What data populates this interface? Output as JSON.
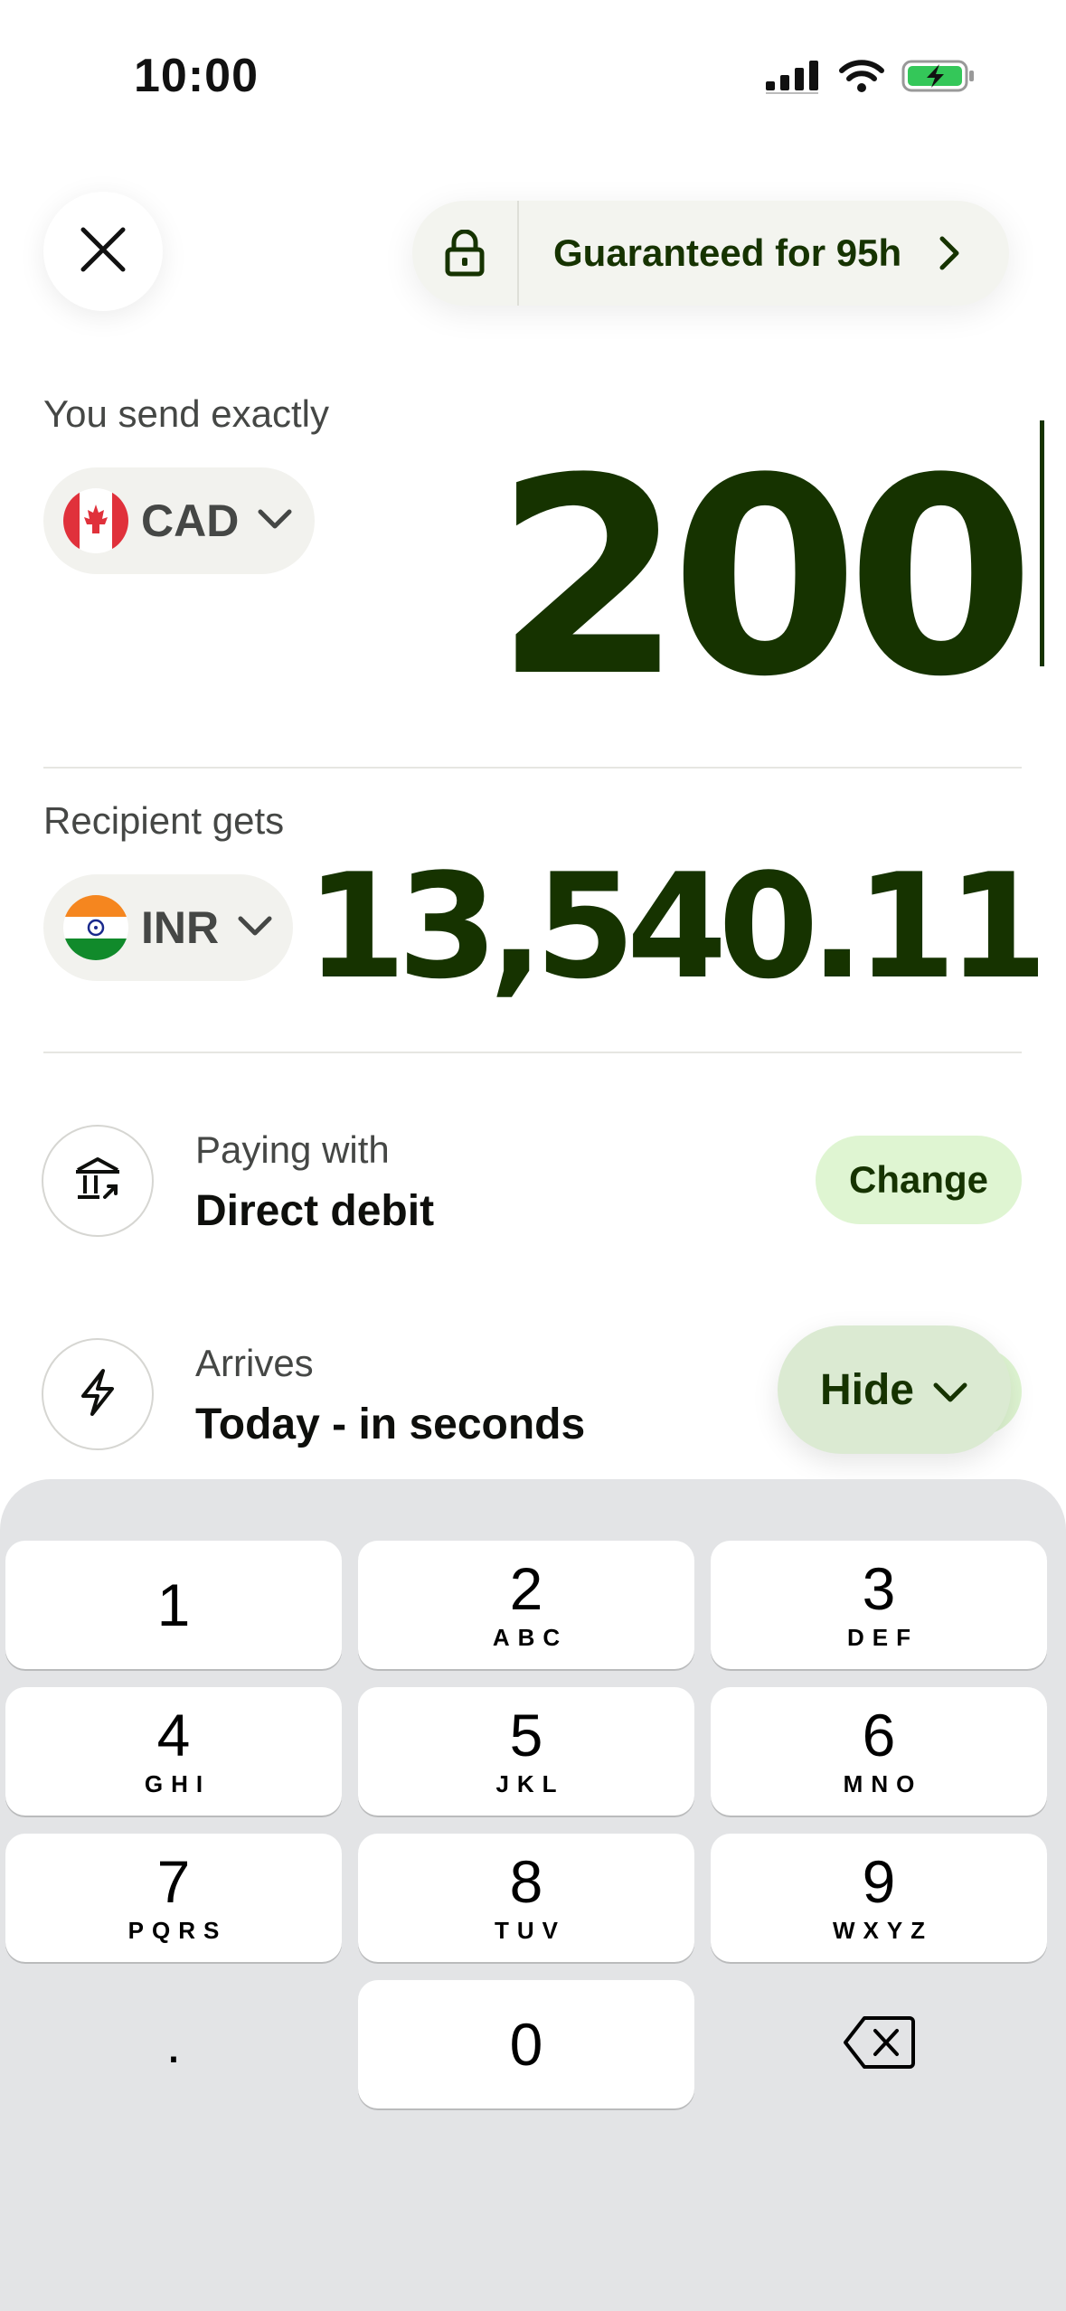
{
  "status_bar": {
    "time": "10:00",
    "icons": [
      "cellular-signal-icon",
      "wifi-icon",
      "battery-charging-icon"
    ],
    "battery_color": "#34c759"
  },
  "header": {
    "close_icon": "close-icon",
    "guarantee_label": "Guaranteed for 95h",
    "lock_icon": "lock-icon",
    "chevron_icon": "chevron-right-icon"
  },
  "send": {
    "label": "You send exactly",
    "currency": "CAD",
    "amount": "200"
  },
  "receive": {
    "label": "Recipient gets",
    "currency": "INR",
    "amount": "13,540.11"
  },
  "paying": {
    "label": "Paying with",
    "value": "Direct debit",
    "action": "Change",
    "icon": "bank-icon"
  },
  "arrives": {
    "label": "Arrives",
    "value": "Today - in seconds",
    "action": "Hide",
    "icon": "lightning-icon"
  },
  "keypad": {
    "keys": [
      {
        "num": "1",
        "letters": ""
      },
      {
        "num": "2",
        "letters": "ABC"
      },
      {
        "num": "3",
        "letters": "DEF"
      },
      {
        "num": "4",
        "letters": "GHI"
      },
      {
        "num": "5",
        "letters": "JKL"
      },
      {
        "num": "6",
        "letters": "MNO"
      },
      {
        "num": "7",
        "letters": "PQRS"
      },
      {
        "num": "8",
        "letters": "TUV"
      },
      {
        "num": "9",
        "letters": "WXYZ"
      },
      {
        "num": "0",
        "letters": ""
      }
    ],
    "decimal": ".",
    "backspace_icon": "backspace-icon"
  },
  "colors": {
    "brand_dark": "#163300",
    "brand_light": "#dff5d2",
    "pill_bg": "#f2f2ee"
  }
}
